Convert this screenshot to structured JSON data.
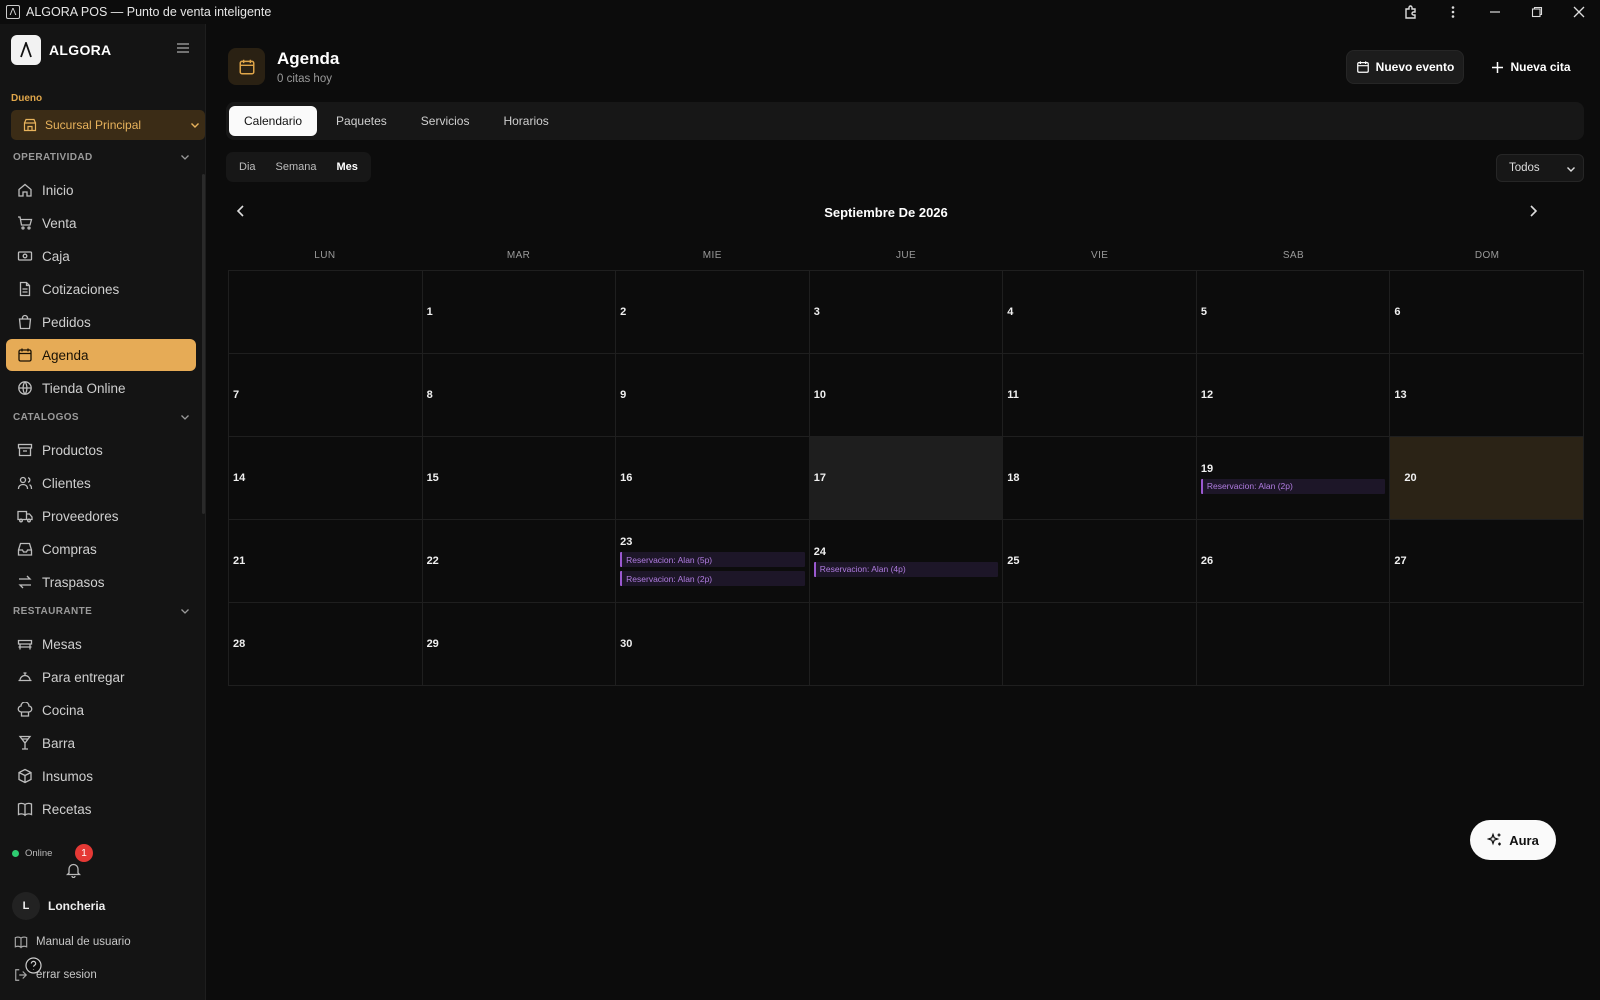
{
  "window": {
    "title": "ALGORA POS — Punto de venta inteligente",
    "logo_char": "Λ"
  },
  "sidebar": {
    "brand": "ALGORA",
    "role": "Dueno",
    "branch": "Sucursal Principal",
    "sections": {
      "operatividad": "OPERATIVIDAD",
      "catalogos": "CATALOGOS",
      "restaurante": "RESTAURANTE"
    },
    "items": [
      {
        "label": "Inicio",
        "icon": "home-icon"
      },
      {
        "label": "Venta",
        "icon": "cart-icon"
      },
      {
        "label": "Caja",
        "icon": "cash-icon"
      },
      {
        "label": "Cotizaciones",
        "icon": "document-icon"
      },
      {
        "label": "Pedidos",
        "icon": "bag-icon"
      },
      {
        "label": "Agenda",
        "icon": "calendar-icon",
        "active": true
      },
      {
        "label": "Tienda Online",
        "icon": "globe-icon"
      },
      {
        "label": "Productos",
        "icon": "archive-icon"
      },
      {
        "label": "Clientes",
        "icon": "users-icon"
      },
      {
        "label": "Proveedores",
        "icon": "truck-icon"
      },
      {
        "label": "Compras",
        "icon": "inbox-icon"
      },
      {
        "label": "Traspasos",
        "icon": "transfer-icon"
      },
      {
        "label": "Mesas",
        "icon": "table-icon"
      },
      {
        "label": "Para entregar",
        "icon": "delivery-icon"
      },
      {
        "label": "Cocina",
        "icon": "chef-hat-icon"
      },
      {
        "label": "Barra",
        "icon": "glass-icon"
      },
      {
        "label": "Insumos",
        "icon": "box-icon"
      },
      {
        "label": "Recetas",
        "icon": "book-icon"
      }
    ],
    "status": "Online",
    "notifications": "1",
    "user_initial": "L",
    "user_name": "Loncheria",
    "manual": "Manual de usuario",
    "logout": "errar sesion"
  },
  "header": {
    "title": "Agenda",
    "subtitle": "0 citas hoy",
    "btn_event": "Nuevo evento",
    "btn_appointment": "Nueva cita"
  },
  "tabs": [
    "Calendario",
    "Paquetes",
    "Servicios",
    "Horarios"
  ],
  "views": [
    "Dia",
    "Semana",
    "Mes"
  ],
  "filter": "Todos",
  "calendar": {
    "month_title": "Septiembre De 2026",
    "weekdays": [
      "LUN",
      "MAR",
      "MIE",
      "JUE",
      "VIE",
      "SAB",
      "DOM"
    ],
    "cells": [
      {
        "day": ""
      },
      {
        "day": "1"
      },
      {
        "day": "2"
      },
      {
        "day": "3"
      },
      {
        "day": "4"
      },
      {
        "day": "5"
      },
      {
        "day": "6"
      },
      {
        "day": "7"
      },
      {
        "day": "8"
      },
      {
        "day": "9"
      },
      {
        "day": "10"
      },
      {
        "day": "11"
      },
      {
        "day": "12"
      },
      {
        "day": "13"
      },
      {
        "day": "14"
      },
      {
        "day": "15"
      },
      {
        "day": "16"
      },
      {
        "day": "17",
        "today": true
      },
      {
        "day": "18"
      },
      {
        "day": "19",
        "events": [
          "Reservacion: Alan (2p)"
        ]
      },
      {
        "day": "20",
        "highlight": true
      },
      {
        "day": "21"
      },
      {
        "day": "22"
      },
      {
        "day": "23",
        "events": [
          "Reservacion: Alan (5p)",
          "Reservacion: Alan (2p)"
        ]
      },
      {
        "day": "24",
        "events": [
          "Reservacion: Alan (4p)"
        ]
      },
      {
        "day": "25"
      },
      {
        "day": "26"
      },
      {
        "day": "27"
      },
      {
        "day": "28"
      },
      {
        "day": "29"
      },
      {
        "day": "30"
      },
      {
        "day": ""
      },
      {
        "day": ""
      },
      {
        "day": ""
      },
      {
        "day": ""
      }
    ]
  },
  "aura_label": "Aura",
  "colors": {
    "accent": "#e6ab56",
    "event": "#9b59d0",
    "badge": "#e53935",
    "online": "#2ecc71"
  }
}
